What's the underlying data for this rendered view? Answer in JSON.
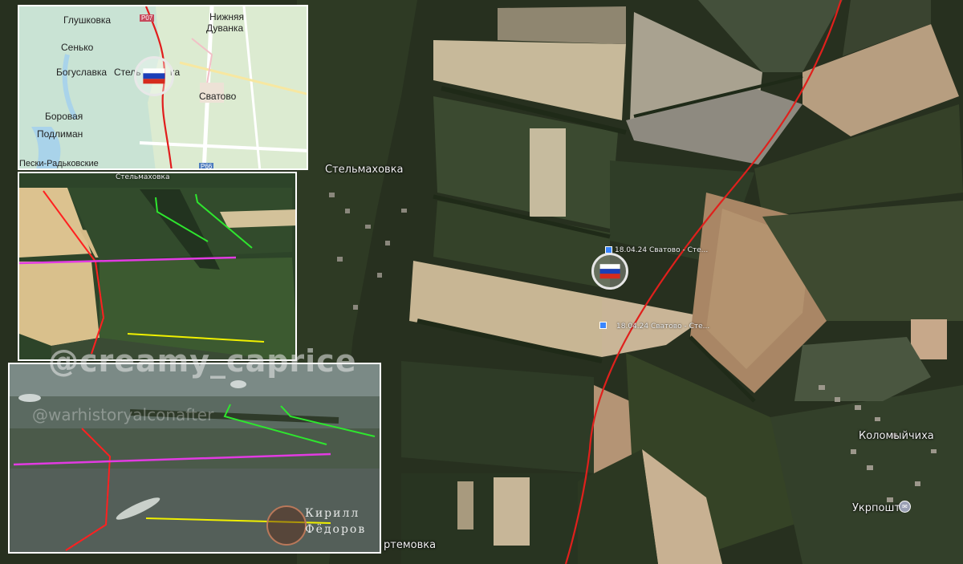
{
  "overview_map": {
    "labels": [
      "Глушковка",
      "Нижняя",
      "Дуванка",
      "Сенько",
      "Богуславка",
      "Стель",
      "ка",
      "Сватово",
      "Боровая",
      "Подлиман",
      "Пески-Радьковские"
    ],
    "road_labels": [
      "P07",
      "P66"
    ],
    "colors": {
      "water": "#b5d9e9",
      "land": "#dcebd1",
      "front_line": "#e11d1d"
    }
  },
  "main_map": {
    "labels": {
      "village_north": "Стельмаховка",
      "village_east": "Коломыйчиха",
      "village_south": "ртемовка",
      "post_office": "Укрпошта"
    },
    "markers": [
      {
        "text": "18.04.24 Сватово - Сте..."
      },
      {
        "text": "18.04.24 Сватово - Сте..."
      }
    ],
    "colors": {
      "front_line": "#e0201c",
      "marker": "#3a86ff"
    }
  },
  "aerial_inset": {
    "village_label": "Стельмаховка",
    "line_colors": {
      "red": "#ff2020",
      "green": "#2ee62e",
      "magenta": "#e23be2",
      "yellow": "#f0f000"
    }
  },
  "drone_inset": {
    "line_colors": {
      "red": "#ff2020",
      "green": "#2ee62e",
      "magenta": "#e23be2",
      "yellow": "#f0f000"
    }
  },
  "watermarks": {
    "primary": "@creamy_caprice",
    "secondary": "@warhistoryalconafter",
    "logo_line1": "Кирилл",
    "logo_line2": "Фёдоров"
  },
  "flag": {
    "colors": [
      "#ffffff",
      "#1c3fb8",
      "#d52b1e"
    ]
  }
}
